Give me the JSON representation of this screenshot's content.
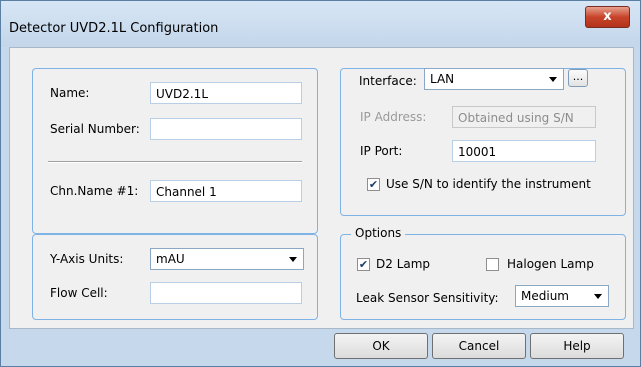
{
  "window": {
    "title": "Detector UVD2.1L Configuration",
    "close_label": "x"
  },
  "identity": {
    "name_label": "Name:",
    "name_value": "UVD2.1L",
    "serial_label": "Serial Number:",
    "serial_value": "",
    "channel_label": "Chn.Name #1:",
    "channel_value": "Channel 1"
  },
  "axis": {
    "yaxis_label": "Y-Axis Units:",
    "yaxis_value": "mAU",
    "flowcell_label": "Flow Cell:",
    "flowcell_value": ""
  },
  "interface": {
    "label": "Interface:",
    "value": "LAN",
    "browse_label": "...",
    "ip_address_label": "IP Address:",
    "ip_address_value": "Obtained using S/N",
    "ip_port_label": "IP Port:",
    "ip_port_value": "10001",
    "use_sn_label": "Use S/N to identify the instrument",
    "use_sn_checked": true
  },
  "options": {
    "title": "Options",
    "d2_label": "D2 Lamp",
    "d2_checked": true,
    "halogen_label": "Halogen Lamp",
    "halogen_checked": false,
    "leak_label": "Leak Sensor Sensitivity:",
    "leak_value": "Medium"
  },
  "buttons": {
    "ok": "OK",
    "cancel": "Cancel",
    "help": "Help"
  }
}
